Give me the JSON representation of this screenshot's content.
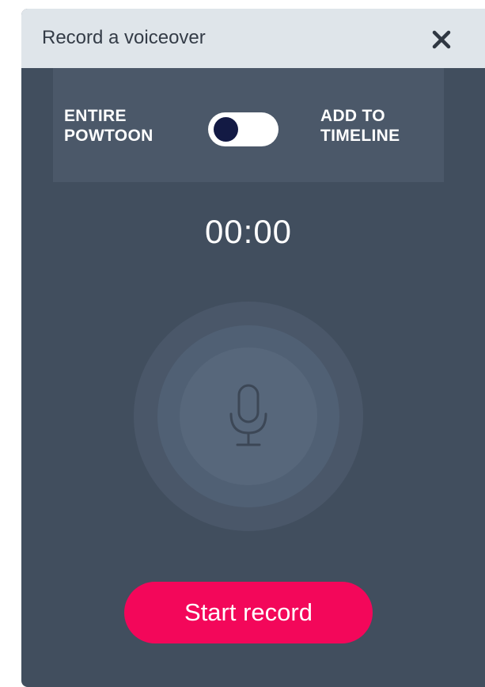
{
  "dialog": {
    "title": "Record a voiceover",
    "close_icon": "close-icon"
  },
  "mode": {
    "left_label_line1": "ENTIRE",
    "left_label_line2": "POWTOON",
    "right_label_line1": "ADD TO",
    "right_label_line2": "TIMELINE",
    "toggle_state": "entire-powtoon"
  },
  "timer": {
    "value": "00:00"
  },
  "recorder": {
    "icon": "microphone-icon"
  },
  "actions": {
    "start_label": "Start record"
  },
  "colors": {
    "panel_bg": "#414e5e",
    "header_bg": "#dfe5ea",
    "accent": "#f3075a",
    "toggle_knob": "#131a44"
  }
}
